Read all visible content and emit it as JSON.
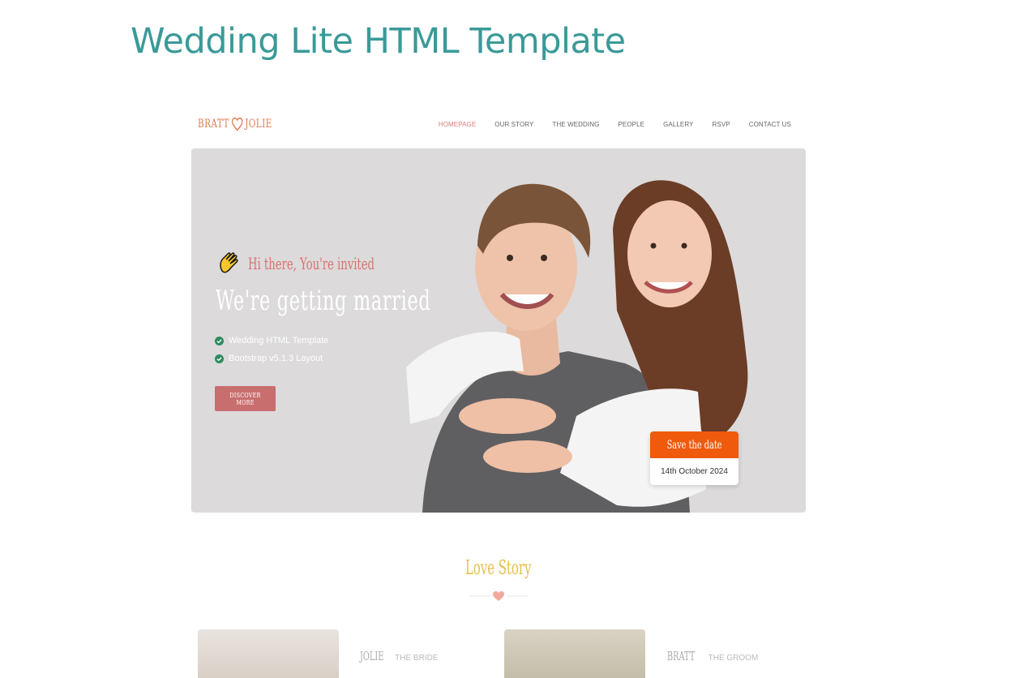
{
  "page": {
    "heading": "Wedding Lite HTML Template"
  },
  "header": {
    "logo_left": "BRATT",
    "logo_right": "JOLIE",
    "nav": [
      {
        "label": "HOMEPAGE",
        "active": true
      },
      {
        "label": "OUR STORY",
        "active": false
      },
      {
        "label": "THE WEDDING",
        "active": false
      },
      {
        "label": "PEOPLE",
        "active": false
      },
      {
        "label": "GALLERY",
        "active": false
      },
      {
        "label": "RSVP",
        "active": false
      },
      {
        "label": "CONTACT US",
        "active": false
      }
    ]
  },
  "hero": {
    "greeting": "Hi there, You're invited",
    "title": "We're getting married",
    "features": [
      "Wedding HTML Template",
      "Bootstrap v5.1.3 Layout"
    ],
    "button_label": "DISCOVER MORE",
    "save_card": {
      "title": "Save the date",
      "date": "14th October 2024"
    }
  },
  "story": {
    "title": "Love Story",
    "bride": {
      "name": "JOLIE",
      "role": "THE BRIDE"
    },
    "groom": {
      "name": "BRATT",
      "role": "THE GROOM"
    }
  },
  "colors": {
    "heading": "#3a9a98",
    "accent": "#e07b52",
    "button": "#c96e6e",
    "save_header": "#f05a0c",
    "story_title": "#e4c04a"
  }
}
